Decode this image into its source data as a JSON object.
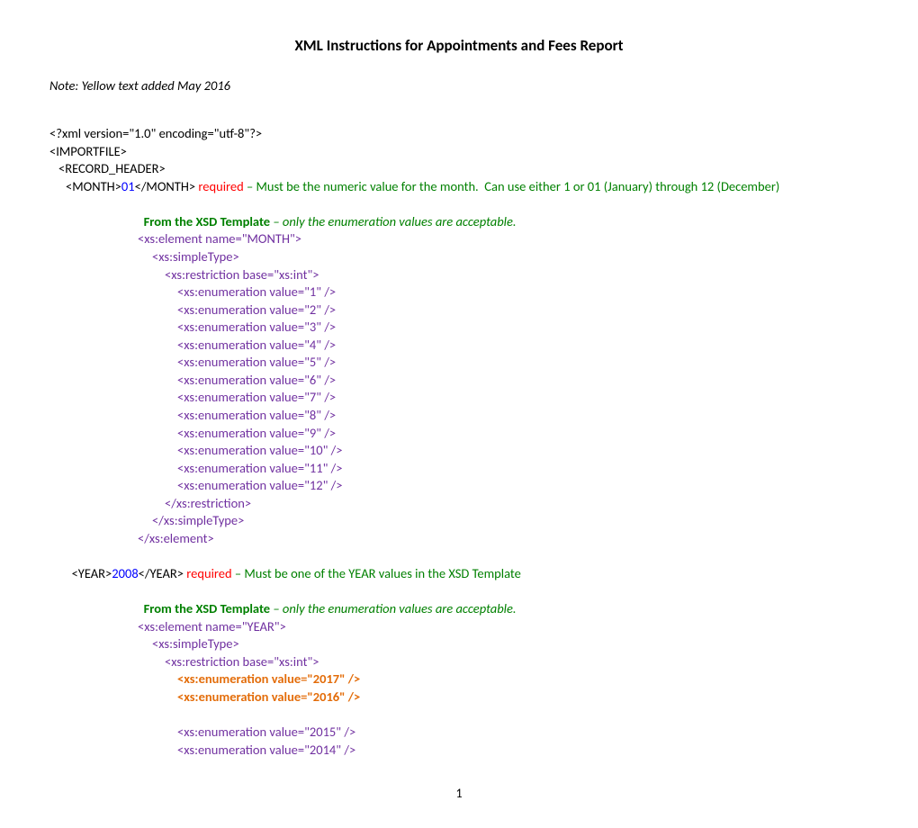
{
  "title": "XML Instructions for Appointments and Fees Report",
  "note": "Note: Yellow text added May 2016",
  "xml_decl": "<?xml version=\"1.0\" encoding=\"utf-8\"?>",
  "importfile": "<IMPORTFILE>",
  "record_header": "<RECORD_HEADER>",
  "month_tag_open": "<MONTH>",
  "month_val": "01",
  "month_tag_close": "</MONTH> ",
  "required": "required ",
  "month_note": "– Must be the numeric value for the month.  Can use either 1 or 01 (January) through 12 (December)",
  "xsd_from": "From the XSD Template ",
  "xsd_note": "– only the enumeration values are acceptable.",
  "month_elem": "<xs:element name=\"MONTH\">",
  "simpletype_open": "<xs:simpleType>",
  "restriction_open": "<xs:restriction base=\"xs:int\">",
  "month_enums": [
    "<xs:enumeration value=\"1\" />",
    "<xs:enumeration value=\"2\" />",
    "<xs:enumeration value=\"3\" />",
    "<xs:enumeration value=\"4\" />",
    "<xs:enumeration value=\"5\" />",
    "<xs:enumeration value=\"6\" />",
    "<xs:enumeration value=\"7\" />",
    "<xs:enumeration value=\"8\" />",
    "<xs:enumeration value=\"9\" />",
    "<xs:enumeration value=\"10\" />",
    "<xs:enumeration value=\"11\" />",
    "<xs:enumeration value=\"12\" />"
  ],
  "restriction_close": "</xs:restriction>",
  "simpletype_close": "</xs:simpleType>",
  "element_close": "</xs:element>",
  "year_tag_open": "<YEAR>",
  "year_val": "2008",
  "year_tag_close": "</YEAR> ",
  "year_note": "– Must be one of the YEAR values in the XSD Template",
  "year_elem": "<xs:element name=\"YEAR\">",
  "year_highlight": [
    "<xs:enumeration value=\"2017\" />",
    "<xs:enumeration value=\"2016\" />"
  ],
  "year_enums": [
    "<xs:enumeration value=\"2015\" />",
    "<xs:enumeration value=\"2014\" />"
  ],
  "pagenum": "1"
}
